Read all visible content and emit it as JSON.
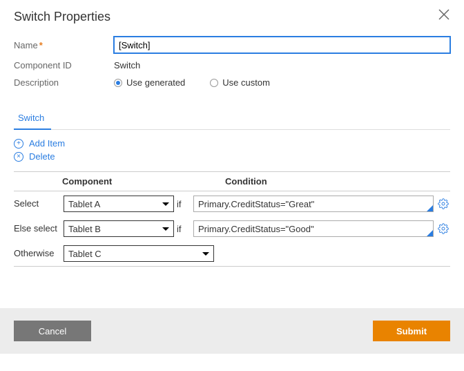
{
  "dialog": {
    "title": "Switch Properties"
  },
  "form": {
    "name_label": "Name",
    "name_value": "[Switch]",
    "component_id_label": "Component ID",
    "component_id_value": "Switch",
    "description_label": "Description",
    "desc_option_generated": "Use generated",
    "desc_option_custom": "Use custom"
  },
  "tabs": {
    "switch": "Switch"
  },
  "actions": {
    "add_item": "Add Item",
    "delete": "Delete"
  },
  "grid": {
    "header_component": "Component",
    "header_condition": "Condition",
    "if_label": "if",
    "rows": [
      {
        "label": "Select",
        "component": "Tablet A",
        "condition": "Primary.CreditStatus=\"Great\""
      },
      {
        "label": "Else select",
        "component": "Tablet B",
        "condition": "Primary.CreditStatus=\"Good\""
      }
    ],
    "otherwise_label": "Otherwise",
    "otherwise_component": "Tablet C"
  },
  "footer": {
    "cancel": "Cancel",
    "submit": "Submit"
  }
}
